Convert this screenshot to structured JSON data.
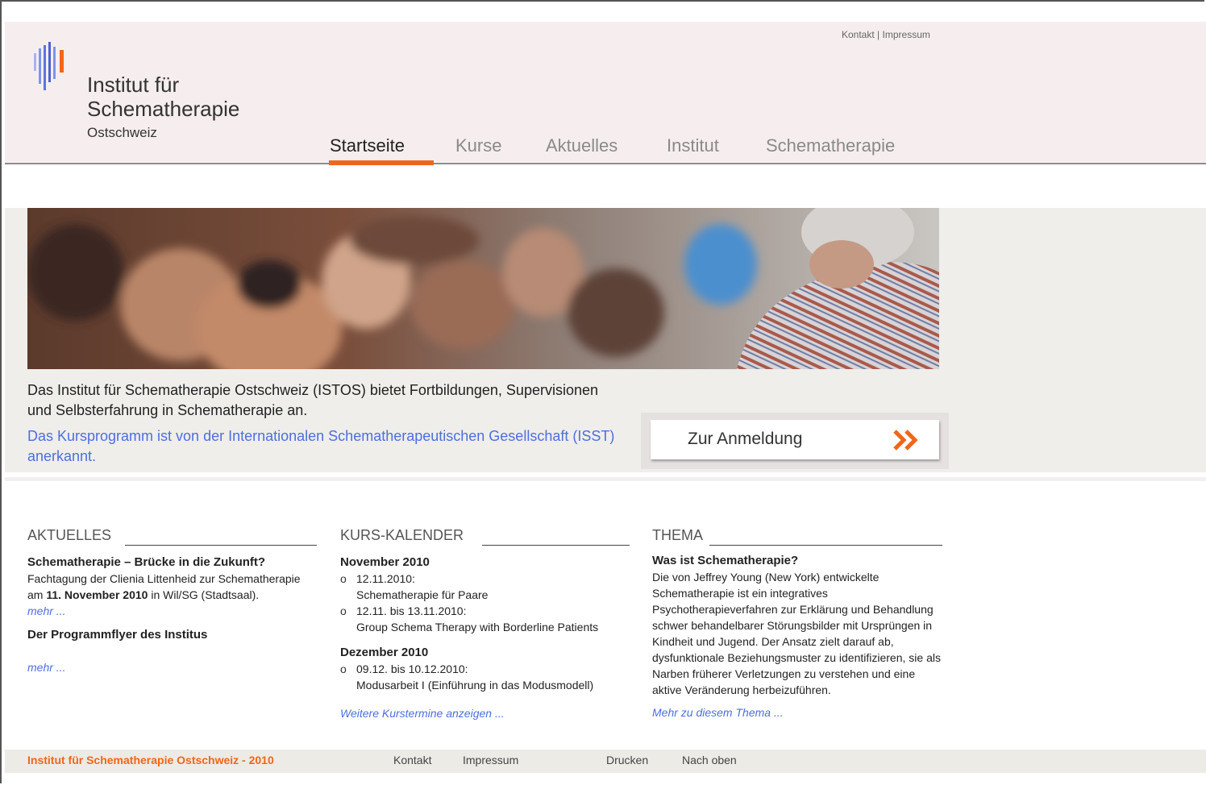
{
  "top_links": {
    "kontakt": "Kontakt",
    "separator": "|",
    "impressum": "Impressum"
  },
  "logo": {
    "line1": "Institut für",
    "line2": "Schematherapie",
    "sub": "Ostschweiz"
  },
  "nav": [
    "Startseite",
    "Kurse",
    "Aktuelles",
    "Institut",
    "Schematherapie"
  ],
  "hero": {
    "intro": "Das Institut für Schematherapie Ostschweiz (ISTOS) bietet Fortbildungen, Supervisionen und Selbsterfahrung in Schematherapie an.",
    "isst": "Das Kursprogramm ist von der Internationalen Schematherapeutischen Gesellschaft (ISST) anerkannt.",
    "button": "Zur Anmeldung"
  },
  "aktuelles": {
    "heading": "AKTUELLES",
    "item1_title": "Schematherapie – Brücke in die Zukunft?",
    "item1_text_a": "Fachtagung der Clienia Littenheid zur Schematherapie am ",
    "item1_text_bold": "11. November 2010",
    "item1_text_b": " in Wil/SG (Stadtsaal).",
    "item1_more": "mehr ...",
    "item2_title": "Der Programmflyer des Institus",
    "item2_more": "mehr ..."
  },
  "kalender": {
    "heading": "KURS-KALENDER",
    "month1": "November 2010",
    "m1e1_date": "12.11.2010:",
    "m1e1_title": "Schematherapie für Paare",
    "m1e2_date": "12.11. bis 13.11.2010:",
    "m1e2_title": "Group Schema Therapy with Borderline Patients",
    "month2": "Dezember 2010",
    "m2e1_date": "09.12. bis 10.12.2010:",
    "m2e1_title": "Modusarbeit I (Einführung in das Modusmodell)",
    "more": "Weitere Kurstermine anzeigen ..."
  },
  "thema": {
    "heading": "THEMA",
    "title": "Was ist Schematherapie?",
    "text": "Die von Jeffrey Young (New York) entwickelte Schematherapie ist ein integratives Psychotherapieverfahren zur Erklärung und Behandlung schwer behandelbarer Störungsbilder mit Ursprüngen in Kindheit und Jugend. Der Ansatz zielt darauf ab, dysfunktionale Beziehungsmuster zu identifizieren, sie als Narben früherer Verletzungen zu verstehen und eine aktive Veränderung herbeizuführen.",
    "more": "Mehr zu diesem Thema ..."
  },
  "footer": {
    "brand": "Institut für Schematherapie Ostschweiz - 2010",
    "kontakt": "Kontakt",
    "impressum": "Impressum",
    "drucken": "Drucken",
    "nach_oben": "Nach oben"
  },
  "colors": {
    "accent": "#f0661a",
    "link": "#4d6fe0",
    "header_bg": "#f6eeee",
    "hero_bg": "#efeeea"
  }
}
